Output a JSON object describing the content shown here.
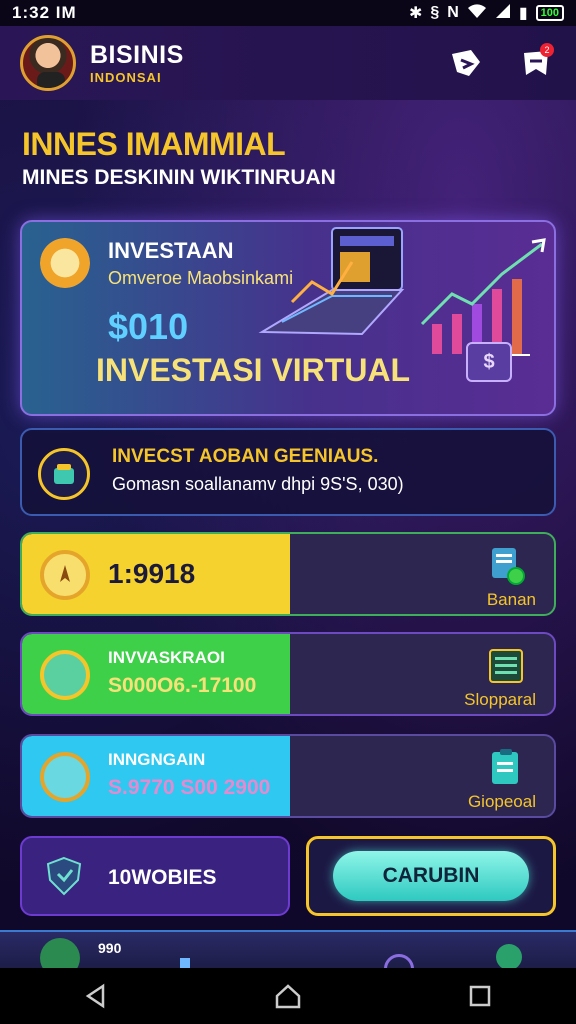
{
  "status_bar": {
    "time": "1:32 IM",
    "battery": "100"
  },
  "header": {
    "title": "BISINIS",
    "subtitle": "INDONSAI",
    "notification_count": "2"
  },
  "hero": {
    "title": "INNES IMAMMIAL",
    "subtitle": "MINES DESKININ WIKTINRUAN"
  },
  "banner": {
    "title": "INVESTAAN",
    "subtitle": "Omveroe  Maobsinkami",
    "amount": "$010",
    "label": "INVESTASI  VIRTUAL",
    "badge": "$"
  },
  "info_card": {
    "title": "INVECST AOBAN GEENIAUS.",
    "subtitle": "Gomasn soallanamv dhpi 9S'S, 030)"
  },
  "rows": [
    {
      "value": "1:9918",
      "side_label": "Banan",
      "fill_fraction": 0.5,
      "color": "#f5d22e"
    },
    {
      "title": "INVVASKRAOI",
      "value": "S000O6.-17100",
      "side_label": "Slopparal",
      "fill_fraction": 0.5,
      "color": "#3fd04a"
    },
    {
      "title": "INNGNGAIN",
      "value": "S.9770 S00 2900",
      "side_label": "Giopeoal",
      "fill_fraction": 0.5,
      "color": "#2ec8f0"
    }
  ],
  "bottom": {
    "left_label": "10WOBIES",
    "cta_label": "CARUBIN"
  },
  "tab_bar": {
    "first_label": "990"
  },
  "colors": {
    "accent_gold": "#f5c52a",
    "accent_cyan": "#5fd0ff",
    "bg": "#120a2e"
  }
}
